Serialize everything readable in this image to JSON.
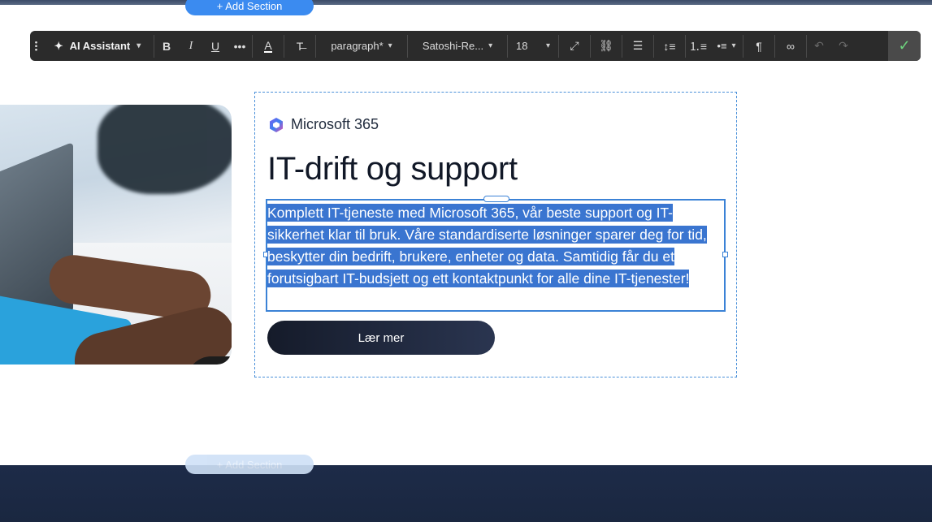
{
  "editor": {
    "add_section_label": "+ Add Section",
    "toolbar": {
      "ai_label": "AI Assistant",
      "style_value": "paragraph*",
      "font_value": "Satoshi-Re...",
      "size_value": "18"
    }
  },
  "card": {
    "brand": "Microsoft 365",
    "headline": "IT-drift og support",
    "body_lines": [
      "Komplett IT-tjeneste med Microsoft 365, vår beste support og IT-",
      "sikkerhet klar til bruk. Våre standardiserte løsninger sparer deg for tid,",
      "beskytter din bedrift, brukere, enheter og data. Samtidig får du et",
      "forutsigbart IT-budsjett og ett kontaktpunkt for alle dine IT-tjenester!"
    ],
    "cta_label": "Lær mer"
  },
  "colors": {
    "selection": "#3a75d0",
    "toolbar_bg": "#2b2b2b",
    "accent": "#3b8bf0",
    "footer": "#1d2b48",
    "cta": "#151b2a"
  }
}
